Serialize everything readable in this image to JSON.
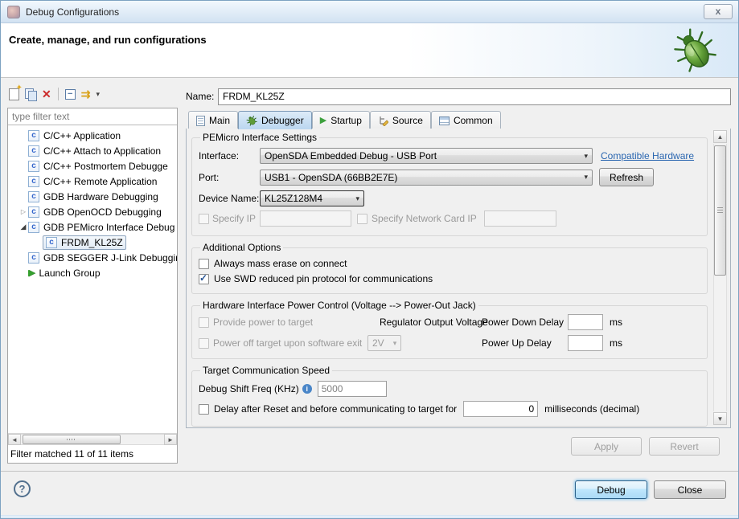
{
  "window": {
    "title": "Debug Configurations"
  },
  "header": {
    "title": "Create, manage, and run configurations"
  },
  "left_panel": {
    "filter_placeholder": "type filter text",
    "tree": [
      {
        "label": "C/C++ Application"
      },
      {
        "label": "C/C++ Attach to Application"
      },
      {
        "label": "C/C++ Postmortem Debugge"
      },
      {
        "label": "C/C++ Remote Application"
      },
      {
        "label": "GDB Hardware Debugging"
      },
      {
        "label": "GDB OpenOCD Debugging",
        "state": "collapsed"
      },
      {
        "label": "GDB PEMicro Interface Debug",
        "state": "expanded"
      },
      {
        "label": "FRDM_KL25Z",
        "selected": true,
        "child": true
      },
      {
        "label": "GDB SEGGER J-Link Debuggin"
      },
      {
        "label": "Launch Group",
        "icon": "launch-group"
      }
    ],
    "status": "Filter matched 11 of 11 items"
  },
  "right_panel": {
    "name_label": "Name:",
    "name_value": "FRDM_KL25Z",
    "tabs": [
      {
        "label": "Main"
      },
      {
        "label": "Debugger",
        "selected": true
      },
      {
        "label": "Startup"
      },
      {
        "label": "Source"
      },
      {
        "label": "Common"
      }
    ],
    "pemicro": {
      "title": "PEMicro Interface Settings",
      "interface_label": "Interface:",
      "interface_value": "OpenSDA Embedded Debug - USB Port",
      "compatible_link": "Compatible Hardware",
      "port_label": "Port:",
      "port_value": "USB1 - OpenSDA (66BB2E7E)",
      "refresh_label": "Refresh",
      "device_label": "Device Name:",
      "device_value": "KL25Z128M4",
      "specify_ip_label": "Specify IP",
      "specify_ip_checked": false,
      "specify_network_label": "Specify Network Card IP",
      "specify_network_checked": false
    },
    "additional": {
      "title": "Additional Options",
      "mass_erase_label": "Always mass erase on connect",
      "mass_erase_checked": false,
      "swd_label": "Use SWD reduced pin protocol for communications",
      "swd_checked": true
    },
    "power": {
      "title": "Hardware Interface Power Control (Voltage --> Power-Out Jack)",
      "provide_power_label": "Provide power to target",
      "provide_power_checked": false,
      "regulator_label": "Regulator Output Voltage",
      "power_down_label": "Power Down Delay",
      "power_off_label": "Power off target upon software exit",
      "power_off_checked": false,
      "voltage_value": "2V",
      "power_up_label": "Power Up Delay",
      "ms_label": "ms"
    },
    "speed": {
      "title": "Target Communication Speed",
      "freq_label": "Debug Shift Freq (KHz)",
      "freq_value": "5000",
      "delay_label": "Delay after Reset and before communicating to target for",
      "delay_checked": false,
      "delay_value": "0",
      "delay_unit": "milliseconds (decimal)"
    },
    "apply_label": "Apply",
    "revert_label": "Revert"
  },
  "footer": {
    "help_label": "?",
    "debug_label": "Debug",
    "close_label": "Close"
  },
  "icons": {
    "close_glyph": "x",
    "delete_glyph": "✕",
    "collapse_glyph": "−",
    "filter_glyph": "⇉",
    "menu_caret_glyph": "▾",
    "collapsed_glyph": "▷",
    "expanded_glyph": "◢",
    "c_glyph": "c",
    "launch_glyph": "▶",
    "startup_glyph": "▶",
    "check_glyph": "✓",
    "combo_arrow_glyph": "▾",
    "info_glyph": "i",
    "help_glyph": "?",
    "scroll_up_glyph": "▲",
    "scroll_down_glyph": "▼",
    "scroll_left_glyph": "◄",
    "scroll_right_glyph": "►"
  },
  "colors": {
    "link": "#2a66b0",
    "tab_selected": "#bcd7f0",
    "default_button_glow": "#8ec6ea",
    "delete_icon": "#cc2b2b",
    "launch_icon": "#35a02f",
    "check": "#2b5797",
    "titlebar": "#d2e2f2"
  }
}
